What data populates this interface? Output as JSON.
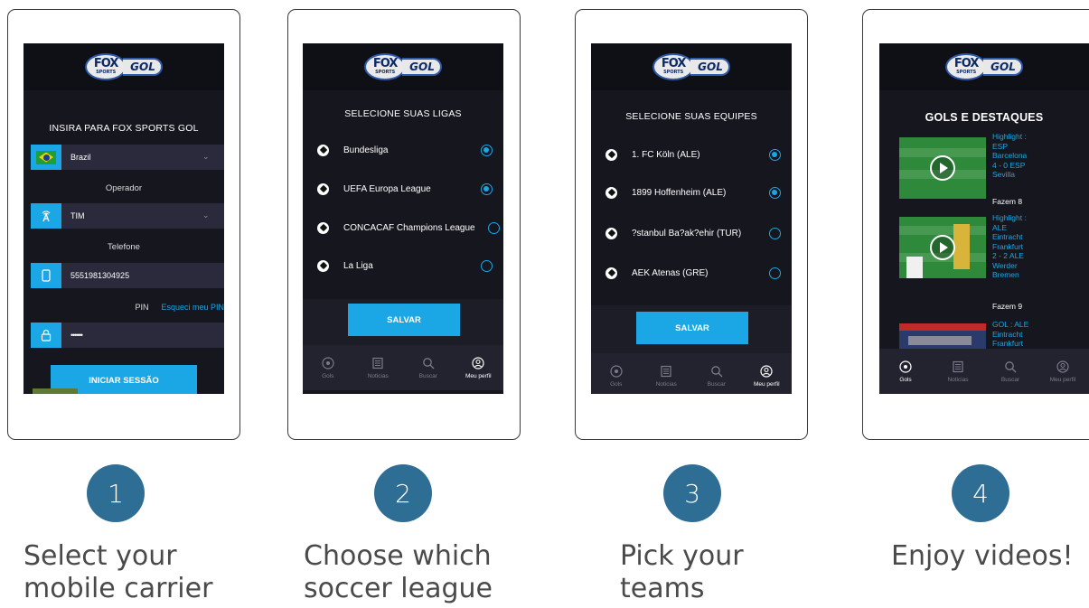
{
  "brand": {
    "fox": "FOX",
    "sports": "SPORTS",
    "gol": "GOL"
  },
  "screen1": {
    "title": "INSIRA PARA FOX SPORTS GOL",
    "country": "Brazil",
    "operator_label": "Operador",
    "operator": "TIM",
    "phone_label": "Telefone",
    "phone": "5551981304925",
    "pin_label": "PIN",
    "forgot_pin": "Esqueci meu PIN",
    "pin_value": "••••••",
    "login_button": "INICIAR SESSÃO"
  },
  "screen2": {
    "title": "SELECIONE SUAS LIGAS",
    "items": [
      {
        "label": "Bundesliga",
        "selected": true
      },
      {
        "label": "UEFA Europa League",
        "selected": true
      },
      {
        "label": "CONCACAF Champions League",
        "selected": false
      },
      {
        "label": "La Liga",
        "selected": false
      }
    ],
    "save_button": "SALVAR"
  },
  "screen3": {
    "title": "SELECIONE SUAS EQUIPES",
    "items": [
      {
        "label": "1. FC Köln (ALE)",
        "selected": true
      },
      {
        "label": "1899 Hoffenheim (ALE)",
        "selected": true
      },
      {
        "label": "?stanbul Ba?ak?ehir (TUR)",
        "selected": false
      },
      {
        "label": "AEK Atenas (GRE)",
        "selected": false
      }
    ],
    "save_button": "SALVAR"
  },
  "screen4": {
    "title": "GOLS E DESTAQUES",
    "videos": [
      {
        "meta": "Highlight :\nESP\nBarcelona\n4 - 0 ESP\nSevilla",
        "sub": "Fazem 8"
      },
      {
        "meta": "Highlight :\nALE\nEintracht\nFrankfurt\n2 - 2 ALE\nWerder\nBremen",
        "sub": "Fazem 9"
      },
      {
        "meta": "GOL : ALE\nEintracht\nFrankfurt",
        "sub": ""
      }
    ]
  },
  "nav": {
    "gols": "Gols",
    "noticias": "Noticias",
    "buscar": "Buscar",
    "perfil": "Meu perfil"
  },
  "steps": [
    {
      "number": "1",
      "caption": "Select your\nmobile carrier"
    },
    {
      "number": "2",
      "caption": "Choose which\nsoccer league"
    },
    {
      "number": "3",
      "caption": "Pick your\nteams"
    },
    {
      "number": "4",
      "caption": "Enjoy videos!"
    }
  ],
  "colors": {
    "accent": "#1ba7e6",
    "screen_bg": "#16161e",
    "step_circle": "#2e6d94"
  }
}
